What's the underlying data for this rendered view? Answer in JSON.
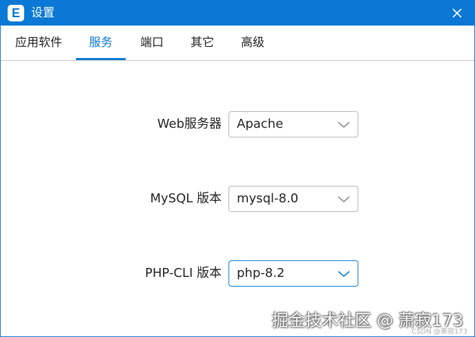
{
  "window": {
    "title": "设置",
    "app_icon_letter": "E",
    "accent": "#0a78d4"
  },
  "tabs": [
    {
      "label": "应用软件",
      "active": false
    },
    {
      "label": "服务",
      "active": true
    },
    {
      "label": "端口",
      "active": false
    },
    {
      "label": "其它",
      "active": false
    },
    {
      "label": "高级",
      "active": false
    }
  ],
  "settings": {
    "web_server": {
      "label": "Web服务器",
      "value": "Apache"
    },
    "mysql": {
      "label": "MySQL 版本",
      "value": "mysql-8.0"
    },
    "php_cli": {
      "label": "PHP-CLI 版本",
      "value": "php-8.2"
    }
  },
  "watermark": {
    "main": "掘金技术社区 @ 萧寂173",
    "small": "CSDN @萧寂173"
  },
  "icons": {
    "close": "close-icon",
    "dropdown": "chevron-down-icon"
  }
}
